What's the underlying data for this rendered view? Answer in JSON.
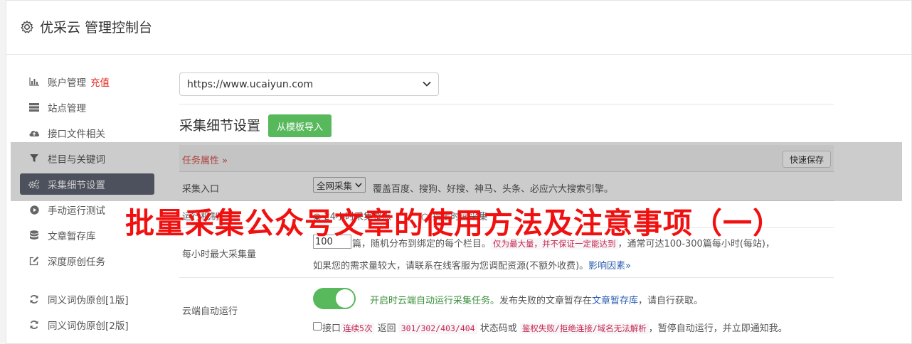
{
  "header": {
    "title": "优采云 管理控制台"
  },
  "sidebar": {
    "items": [
      {
        "label": "账户管理",
        "badge": "充值",
        "icon": "bar-chart-icon"
      },
      {
        "label": "站点管理",
        "icon": "server-icon"
      },
      {
        "label": "接口文件相关",
        "icon": "cloud-upload-icon"
      },
      {
        "label": "栏目与关键词",
        "icon": "filter-icon"
      },
      {
        "label": "采集细节设置",
        "icon": "gears-icon",
        "active": true
      },
      {
        "label": "手动运行测试",
        "icon": "play-circle-icon"
      },
      {
        "label": "文章暂存库",
        "icon": "database-icon"
      },
      {
        "label": "深度原创任务",
        "icon": "edit-icon"
      },
      {
        "label": "同义词伪原创[1版]",
        "icon": "refresh-icon"
      },
      {
        "label": "同义词伪原创[2版]",
        "icon": "refresh-icon"
      }
    ]
  },
  "main": {
    "site_select": "https://www.ucaiyun.com",
    "section_title": "采集细节设置",
    "import_button": "从模板导入",
    "task_attr": "任务属性 »",
    "quick_save": "快速保存",
    "rows": {
      "collect_entry": {
        "label": "采集入口",
        "select": "全网采集",
        "desc": "覆盖百度、搜狗、好搜、神马、头条、必应六大搜索引擎。"
      },
      "run_mode": {
        "label": "运行机制",
        "text_left": "24小时采集整点",
        "text_right": "指定时间采集"
      },
      "max_per_hour": {
        "label": "每小时最大采集量",
        "value": "100",
        "line1_a": "篇，随机分布到绑定的每个栏目。",
        "line1_code": "仅为最大量，并不保证一定能达到",
        "line1_b": "，通常可达100-300篇每小时(每站)，",
        "line2_a": "如果您的需求量较大，请联系在线客服为您调配资源(不额外收费)。",
        "line2_link": "影响因素»"
      },
      "cloud_auto": {
        "label": "云端自动运行",
        "green_a": "开启时云端自动运行采集任务。",
        "plain_a": "发布失败的文章暂存在",
        "link": "文章暂存库",
        "plain_b": "，请自行获取。",
        "cb_a": "接口",
        "code_a": "连续5次",
        "cb_b": "返回",
        "code_b": "301/302/403/404",
        "cb_c": "状态码或",
        "code_c": "鉴权失败/拒绝连接/域名无法解析",
        "cb_d": "，暂停自动运行，并立即通知我。"
      }
    }
  },
  "overlay_title": "批量采集公众号文章的使用方法及注意事项（一）",
  "colors": {
    "active_bg": "#5f6675",
    "green": "#58b85c",
    "red": "#e02a1d",
    "overlay_red": "#f01010"
  }
}
